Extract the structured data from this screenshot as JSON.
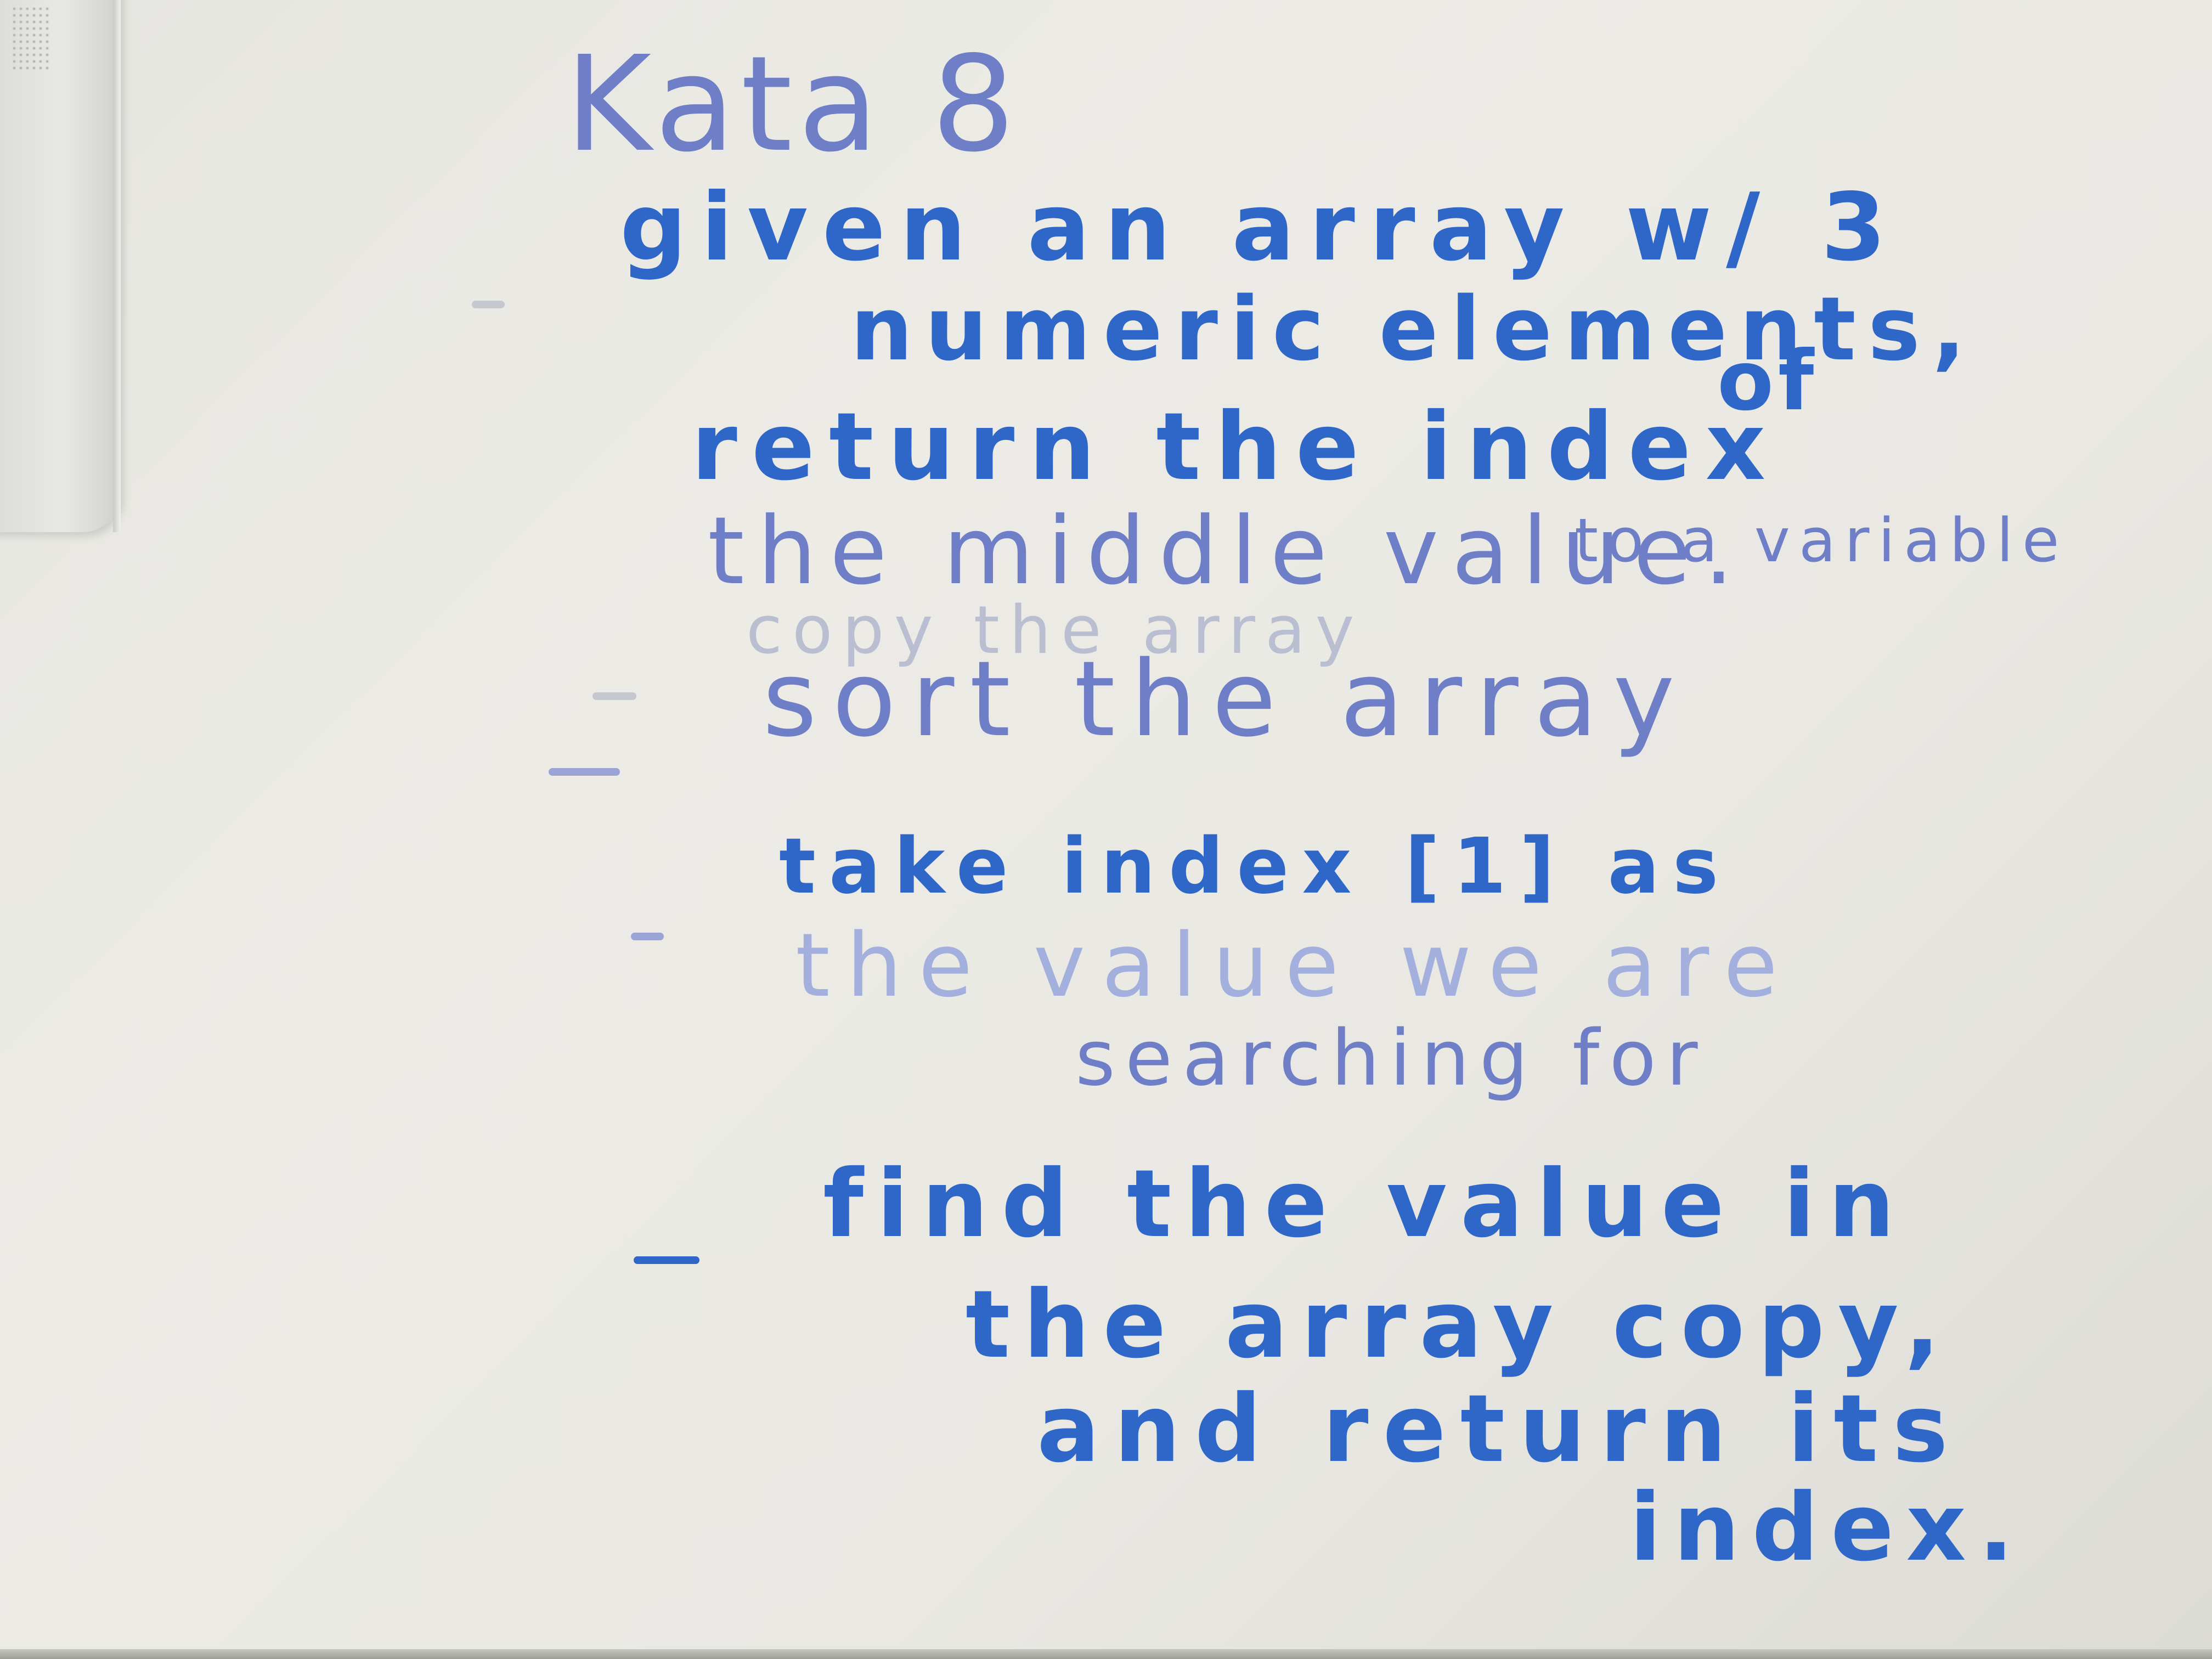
{
  "whiteboard": {
    "title": "Kata 8",
    "lines": [
      "given an array w/ 3",
      "numeric elements,",
      "return the index",
      "of",
      "the middle value.",
      "copy the array",
      "to a variable",
      "sort the array",
      "take index [1] as",
      "the value we are",
      "searching for",
      "find the value in",
      "the array copy,",
      "and return its",
      "index."
    ]
  },
  "colors": {
    "marker_blue": "#2f67c9",
    "faded_marker": "#6f7fc7",
    "board": "#e9e8e3"
  }
}
